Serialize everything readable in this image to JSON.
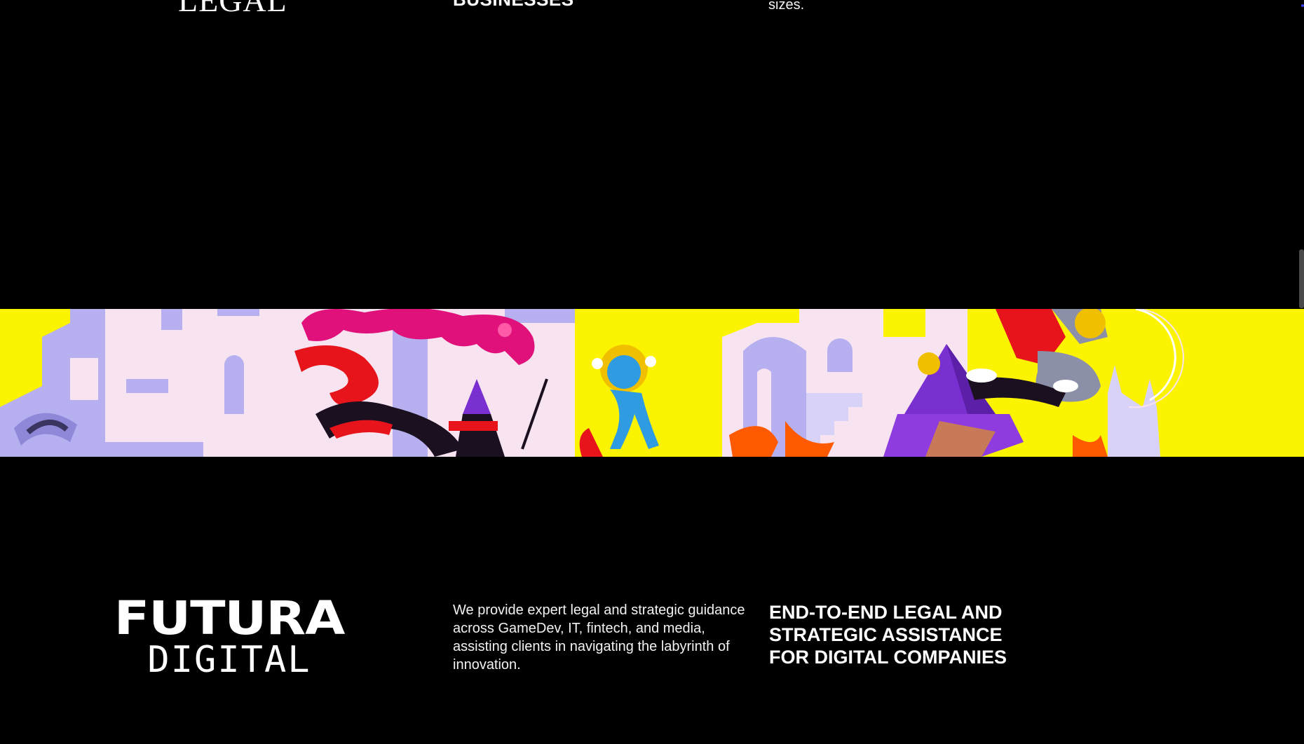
{
  "top_row": {
    "logo_text": "LEGAL",
    "heading_text": "BUSINESSES",
    "body_text_end": "sizes."
  },
  "banner": {
    "background_color": "#fbf300",
    "accent_colors": [
      "#b6b0f0",
      "#f7e4f0",
      "#e0117a",
      "#e8141c",
      "#7a2fd0",
      "#ff5a00",
      "#2f9be0"
    ]
  },
  "footer_brand": {
    "logo_main": "FUTURA",
    "logo_sub": "DIGITAL",
    "description": "We provide expert legal and strategic guidance across GameDev, IT, fintech, and media, assisting clients in navigating the labyrinth of innovation.",
    "tagline": "END-TO-END LEGAL AND STRATEGIC ASSISTANCE FOR DIGITAL COMPANIES"
  },
  "colors": {
    "page_background": "#000000",
    "text": "#ffffff"
  }
}
